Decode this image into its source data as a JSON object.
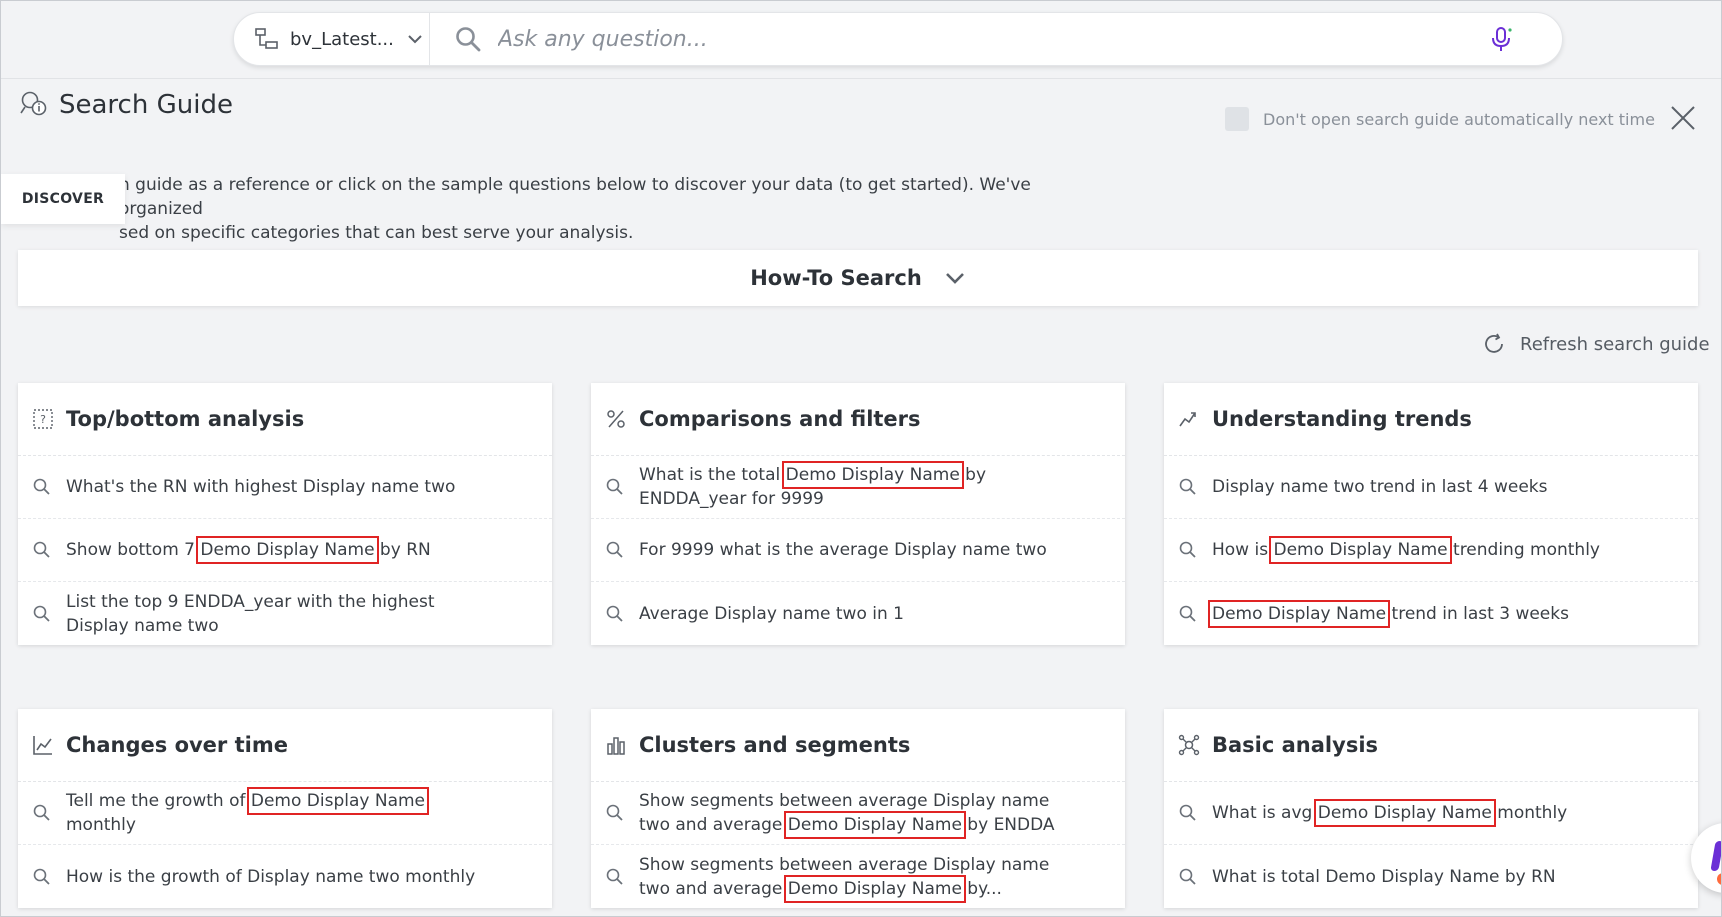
{
  "topbar": {
    "datasource_label": "bv_Latest...",
    "query_placeholder": "Ask any question..."
  },
  "guide": {
    "title": "Search Guide",
    "auto_open_label": "Don't open search guide automatically next time",
    "intro_line1": "h guide as a reference or click on the sample questions below to discover your data (to get started). We've organized",
    "intro_line2": "sed on specific categories that can best serve your analysis.",
    "discover_tab": "DISCOVER",
    "howto_label": "How-To Search",
    "refresh_label": "Refresh search guide"
  },
  "cards": [
    {
      "title": "Top/bottom analysis",
      "icon": "question-table-icon",
      "questions": [
        {
          "pre": "What's the RN with highest Display name two",
          "hl": "",
          "post": ""
        },
        {
          "pre": "Show bottom 7 ",
          "hl": "Demo Display Name",
          "post": " by RN"
        },
        {
          "pre": "List the top 9 ENDDA_year with the highest Display name two",
          "hl": "",
          "post": ""
        }
      ]
    },
    {
      "title": "Comparisons and filters",
      "icon": "percent-icon",
      "questions": [
        {
          "pre": "What is the total ",
          "hl": "Demo Display Name",
          "post": " by ENDDA_year for 9999"
        },
        {
          "pre": "For 9999 what is the average Display name two",
          "hl": "",
          "post": ""
        },
        {
          "pre": "Average Display name two in 1",
          "hl": "",
          "post": ""
        }
      ]
    },
    {
      "title": "Understanding trends",
      "icon": "trend-icon",
      "questions": [
        {
          "pre": "Display name two trend in last 4 weeks",
          "hl": "",
          "post": ""
        },
        {
          "pre": "How is ",
          "hl": "Demo Display Name",
          "post": " trending monthly"
        },
        {
          "pre": "",
          "hl": "Demo Display Name",
          "post": " trend in last 3 weeks"
        }
      ]
    },
    {
      "title": "Changes over time",
      "icon": "line-chart-icon",
      "questions": [
        {
          "pre": "Tell me the growth of ",
          "hl": "Demo Display Name",
          "post": " monthly"
        },
        {
          "pre": "How is the growth of Display name two monthly",
          "hl": "",
          "post": ""
        }
      ]
    },
    {
      "title": "Clusters and segments",
      "icon": "bar-chart-icon",
      "questions": [
        {
          "pre": "Show segments between average Display name two and average ",
          "hl": "Demo Display Name",
          "post": " by ENDDA"
        },
        {
          "pre": "Show segments between average Display name two and average ",
          "hl": "Demo Display Name",
          "post": " by..."
        }
      ]
    },
    {
      "title": "Basic analysis",
      "icon": "nodes-icon",
      "questions": [
        {
          "pre": "What is avg ",
          "hl": "Demo Display Name",
          "post": " monthly"
        },
        {
          "pre": "What is total Demo Display Name by RN",
          "hl": "",
          "post": ""
        }
      ]
    }
  ],
  "colors": {
    "highlight_box": "#e02424",
    "mic_accent": "#6b2fd6",
    "assistant_dot": "#ff6b3d"
  }
}
